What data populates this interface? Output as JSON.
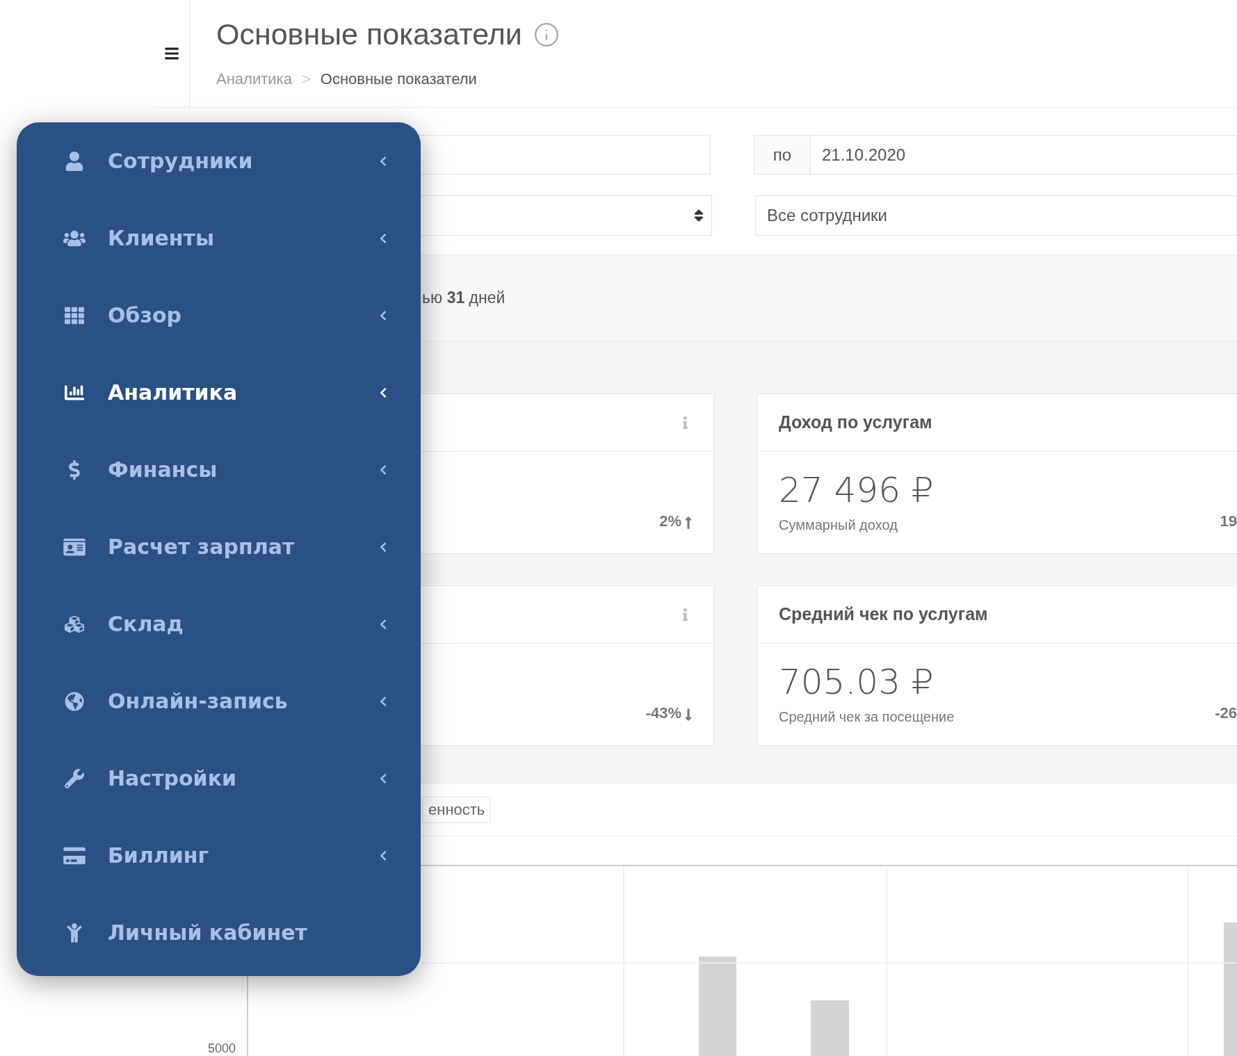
{
  "header": {
    "title": "Основные показатели",
    "breadcrumb_separator": ">",
    "breadcrumb": [
      {
        "label": "Аналитика",
        "current": false
      },
      {
        "label": "Основные показатели",
        "current": true
      }
    ]
  },
  "filters": {
    "date_to_label": "по",
    "date_to": "21.10.2020",
    "employee_select": "Все сотрудники"
  },
  "period_note": "ью **31** дней",
  "left_cards": [
    {
      "change": "2%",
      "kind": "rise"
    },
    {
      "change": "-43%",
      "kind": "fall"
    }
  ],
  "right_cards": [
    {
      "title": "Доход по услугам",
      "value": "27 496 ₽",
      "caption": "Суммарный доход",
      "change": "19"
    },
    {
      "title": "Средний чек по услугам",
      "value": "705.03 ₽",
      "caption": "Средний чек за посещение",
      "change": "-26"
    }
  ],
  "chart_tab": "енность",
  "chart": {
    "y_tick": "5000"
  },
  "menu": [
    {
      "label": "Сотрудники",
      "selected": false,
      "has_submenu": true
    },
    {
      "label": "Клиенты",
      "selected": false,
      "has_submenu": true
    },
    {
      "label": "Обзор",
      "selected": false,
      "has_submenu": true
    },
    {
      "label": "Аналитика",
      "selected": true,
      "has_submenu": true
    },
    {
      "label": "Финансы",
      "selected": false,
      "has_submenu": true
    },
    {
      "label": "Расчет зарплат",
      "selected": false,
      "has_submenu": true
    },
    {
      "label": "Склад",
      "selected": false,
      "has_submenu": true
    },
    {
      "label": "Онлайн-запись",
      "selected": false,
      "has_submenu": true
    },
    {
      "label": "Настройки",
      "selected": false,
      "has_submenu": true
    },
    {
      "label": "Биллинг",
      "selected": false,
      "has_submenu": true
    },
    {
      "label": "Личный кабинет",
      "selected": false,
      "has_submenu": false
    }
  ]
}
